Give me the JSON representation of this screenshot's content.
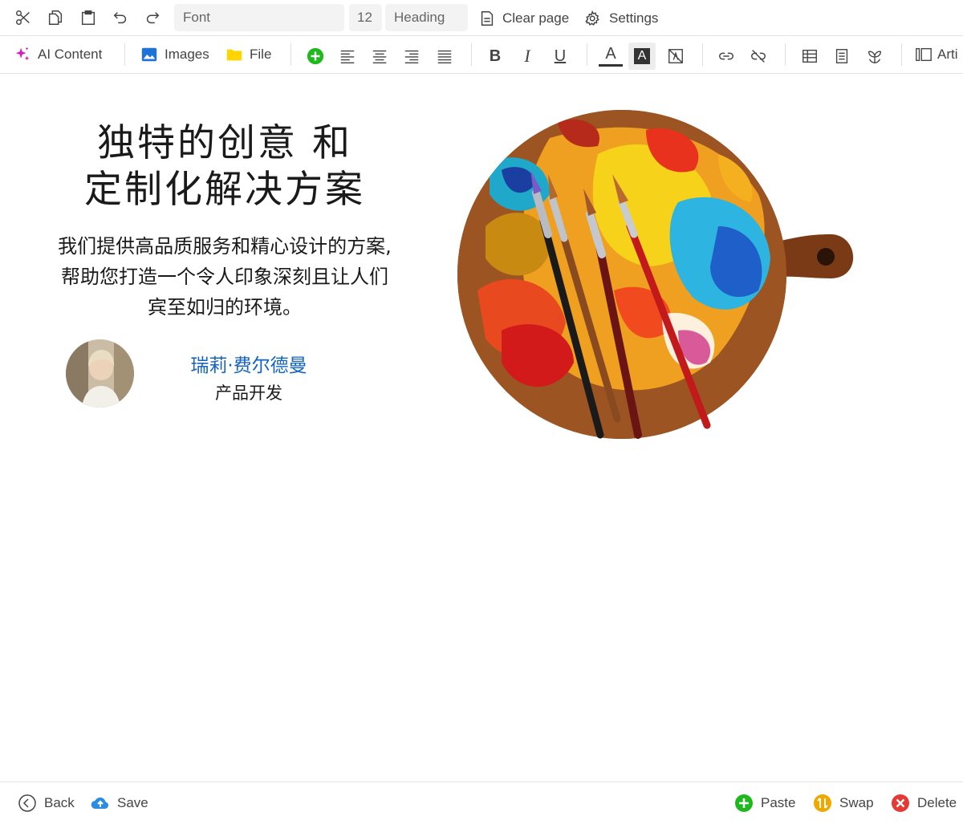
{
  "toolbar_top": {
    "font_placeholder": "Font",
    "font_size": "12",
    "style_value": "Heading",
    "clear_page_label": "Clear page",
    "settings_label": "Settings"
  },
  "toolbar_format": {
    "ai_content_label": "AI Content",
    "images_label": "Images",
    "file_label": "File",
    "bold_glyph": "B",
    "italic_glyph": "I",
    "underline_glyph": "U",
    "text_color_glyph": "A",
    "highlight_glyph": "A",
    "article_label": "Arti"
  },
  "content": {
    "headline_line1": "独特的创意 和",
    "headline_line2": "定制化解决方案",
    "body_line1": "我们提供高品质服务和精心设计的方案,",
    "body_line2": "帮助您打造一个令人印象深刻且让人们",
    "body_line3": "宾至如归的环境。",
    "person_name": "瑞莉·费尔德曼",
    "person_role": "产品开发"
  },
  "footer": {
    "back_label": "Back",
    "save_label": "Save",
    "paste_label": "Paste",
    "swap_label": "Swap",
    "delete_label": "Delete"
  },
  "colors": {
    "ai_accent": "#d81bbf",
    "images_blue": "#1e73d8",
    "file_yellow": "#ffd400",
    "add_green": "#1fb81f",
    "name_blue": "#1565c0",
    "save_blue": "#2a8de0",
    "swap_orange": "#f0a800",
    "delete_red": "#e53935"
  }
}
